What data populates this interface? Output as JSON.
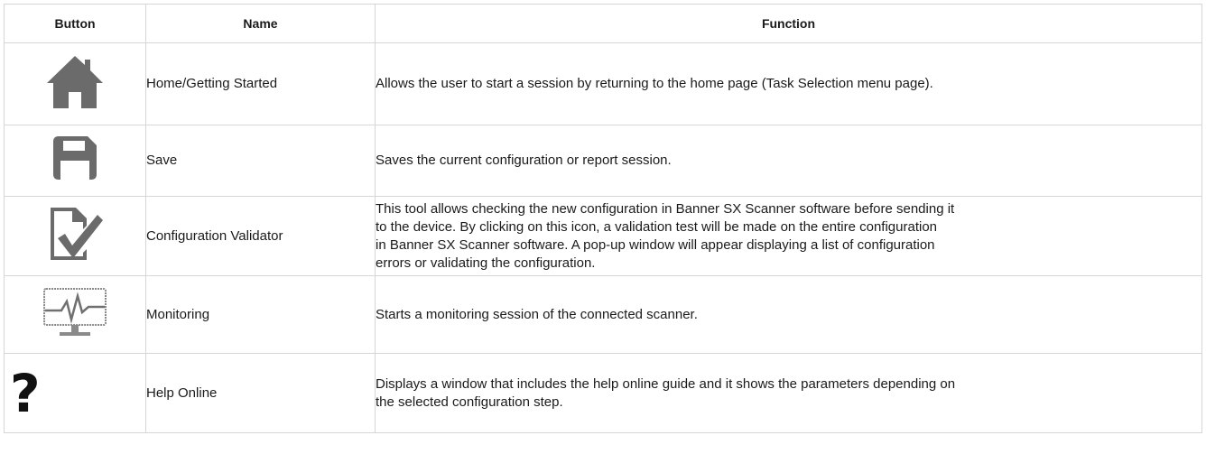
{
  "headers": {
    "button": "Button",
    "name": "Name",
    "function": "Function"
  },
  "rows": [
    {
      "icon": "home-icon",
      "name": "Home/Getting Started",
      "function": "Allows the user to start a session by returning to the home page (Task Selection menu page)."
    },
    {
      "icon": "save-icon",
      "name": "Save",
      "function": "Saves the current configuration or report session."
    },
    {
      "icon": "configuration-validator-icon",
      "name": "Configuration Validator",
      "function_lines": [
        "This tool allows checking the new configuration in Banner SX Scanner software before sending it",
        "to the device. By clicking on this icon, a validation test will be made on the entire configuration",
        "in Banner SX Scanner software. A pop-up window will appear displaying a list of configuration",
        "errors or validating the configuration."
      ]
    },
    {
      "icon": "monitoring-icon",
      "name": "Monitoring",
      "function": "Starts a monitoring session of the connected scanner."
    },
    {
      "icon": "help-icon",
      "icon_glyph": "?",
      "name": "Help Online",
      "function_lines": [
        "Displays a window that includes the help online guide and it shows the parameters depending on",
        "the selected configuration step."
      ]
    }
  ],
  "colors": {
    "icon_gray": "#6b6b6b",
    "border": "#d6d6d6"
  }
}
